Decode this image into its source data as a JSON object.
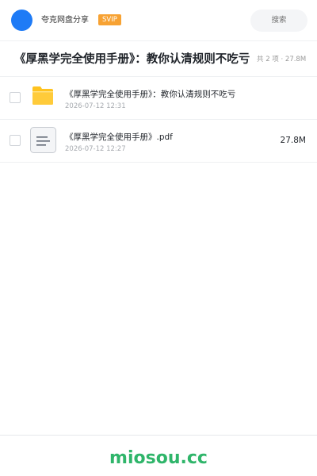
{
  "header": {
    "brand": "夸克网盘分享",
    "badge": "SVIP",
    "search_placeholder": "搜索"
  },
  "share": {
    "title": "《厚黑学完全使用手册》：教你认清规则不吃亏",
    "meta": "共 2 项 · 27.8M"
  },
  "files": [
    {
      "icon": "folder-icon",
      "name": "《厚黑学完全使用手册》：教你认清规则不吃亏",
      "date": "2026-07-12 12:31",
      "size": ""
    },
    {
      "icon": "document-icon",
      "name": "《厚黑学完全使用手册》.pdf",
      "date": "2026-07-12 12:27",
      "size": "27.8M"
    }
  ],
  "footer": {
    "text": "miosou.cc"
  },
  "colors": {
    "avatar": "#1e7bf6",
    "badge": "#f7a233",
    "folder": "#ffc31f",
    "footer_text": "#2fb56a"
  }
}
